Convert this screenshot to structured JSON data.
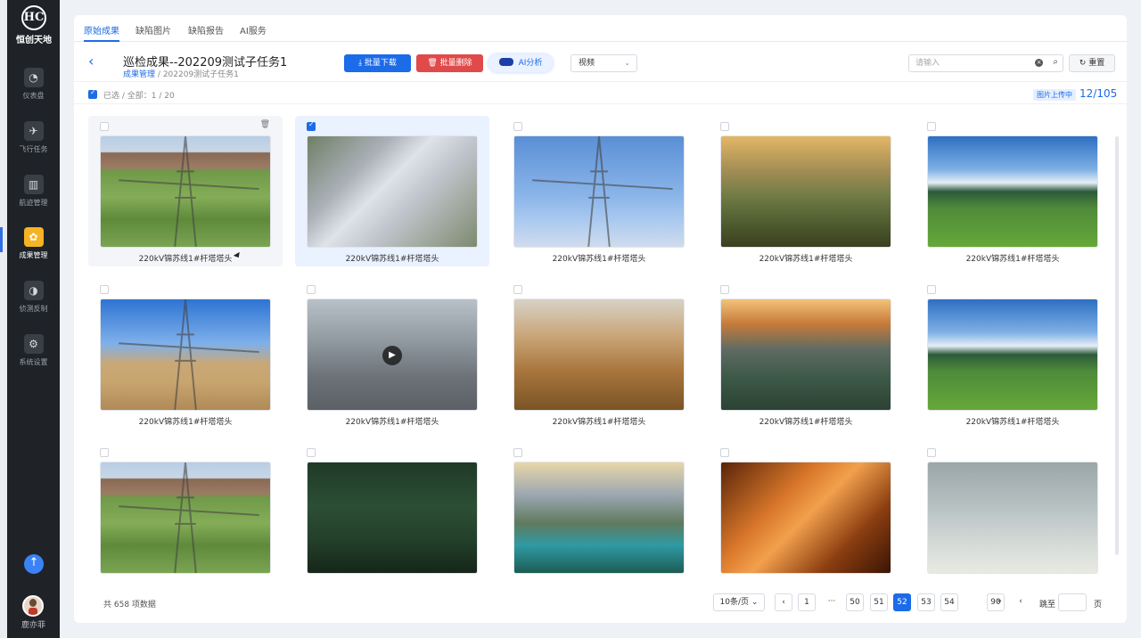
{
  "app": {
    "brand": "恒创天地",
    "logo_mark": "HC",
    "user": "鹿亦菲"
  },
  "sidebar": {
    "items": [
      {
        "label": "仪表盘",
        "icon": "dashboard-icon",
        "glyph": "◔"
      },
      {
        "label": "飞行任务",
        "icon": "plane-icon",
        "glyph": "✈"
      },
      {
        "label": "航迹管理",
        "icon": "map-icon",
        "glyph": "▥"
      },
      {
        "label": "成果管理",
        "icon": "results-icon",
        "glyph": "✿",
        "active": true
      },
      {
        "label": "侦测反制",
        "icon": "radar-icon",
        "glyph": "◑"
      },
      {
        "label": "系统设置",
        "icon": "gear-icon",
        "glyph": "⚙"
      }
    ]
  },
  "tabs": [
    {
      "label": "原始成果",
      "active": true
    },
    {
      "label": "缺陷图片"
    },
    {
      "label": "缺陷报告"
    },
    {
      "label": "AI服务"
    }
  ],
  "header": {
    "title": "巡检成果--202209测试子任务1",
    "breadcrumb_link": "成果管理",
    "breadcrumb_sep": "/",
    "breadcrumb_current": "202209测试子任务1",
    "download_label": "批量下载",
    "delete_label": "批量删除",
    "ai_label": "AI分析",
    "media_select": "视频",
    "search_placeholder": "请输入",
    "reset_label": "重置"
  },
  "selection": {
    "text": "已选 / 全部：1 / 20",
    "upload_badge": "图片上传中",
    "upload_count": "12/105"
  },
  "grid": {
    "items": [
      {
        "caption": "220kV锦苏线1#杆塔塔头",
        "theme": "img-aerial"
      },
      {
        "caption": "220kV锦苏线1#杆塔塔头",
        "theme": "img-insul",
        "checked": true
      },
      {
        "caption": "220kV锦苏线1#杆塔塔头",
        "theme": "img-tower"
      },
      {
        "caption": "220kV锦苏线1#杆塔塔头",
        "theme": "img-valley"
      },
      {
        "caption": "220kV锦苏线1#杆塔塔头",
        "theme": "img-meadow"
      },
      {
        "caption": "220kV锦苏线1#杆塔塔头",
        "theme": "img-desert"
      },
      {
        "caption": "220kV锦苏线1#杆塔塔头",
        "theme": "img-substation",
        "video": true
      },
      {
        "caption": "220kV锦苏线1#杆塔塔头",
        "theme": "img-grass"
      },
      {
        "caption": "220kV锦苏线1#杆塔塔头",
        "theme": "img-sunset"
      },
      {
        "caption": "220kV锦苏线1#杆塔塔头",
        "theme": "img-meadow"
      },
      {
        "caption": "",
        "theme": "img-aerial"
      },
      {
        "caption": "",
        "theme": "img-forest"
      },
      {
        "caption": "",
        "theme": "img-lake"
      },
      {
        "caption": "",
        "theme": "img-canyon"
      },
      {
        "caption": "",
        "theme": "img-sky"
      }
    ]
  },
  "pagination": {
    "total": "共 658 项数据",
    "page_size": "10条/页",
    "prev": "‹",
    "next": "»",
    "next2": "‹",
    "pages": [
      "1",
      "···",
      "50",
      "51",
      "52",
      "53",
      "54",
      "90"
    ],
    "current": "52",
    "jump_label": "跳至",
    "jump_unit": "页"
  },
  "colors": {
    "accent": "#1c6be8",
    "danger": "#e04a4a",
    "sidebar_bg": "#1f2328",
    "active_nav": "#f5b325"
  }
}
